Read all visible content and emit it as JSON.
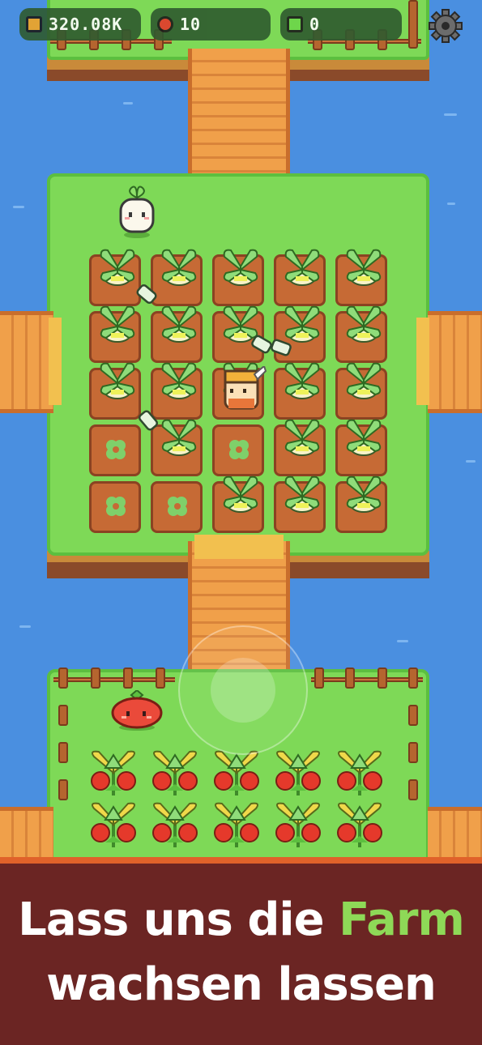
{
  "hud": {
    "coins": "320.08K",
    "tomatoes": "10",
    "gems": "0",
    "settings_icon": "gear-icon",
    "coin_icon": "coin-icon",
    "tomato_icon": "tomato-icon",
    "gem_icon": "gem-icon"
  },
  "banner": {
    "line1_prefix": "Lass uns die",
    "line1_highlight": "Farm",
    "line2": "wachsen lassen"
  },
  "colors": {
    "water": "#4a8fe0",
    "grass": "#7ed957",
    "banner_bg": "#6b2523",
    "highlight": "#8ed957"
  },
  "field": {
    "rows": [
      [
        "turnip",
        "turnip",
        "turnip",
        "turnip",
        "turnip"
      ],
      [
        "turnip",
        "turnip",
        "turnip",
        "turnip",
        "turnip"
      ],
      [
        "turnip",
        "turnip",
        "turnip",
        "turnip",
        "turnip"
      ],
      [
        "sprout",
        "turnip",
        "sprout",
        "turnip",
        "turnip"
      ],
      [
        "sprout",
        "sprout",
        "turnip",
        "turnip",
        "turnip"
      ]
    ]
  },
  "tomato_field": {
    "rows": [
      [
        "tomato",
        "tomato",
        "tomato",
        "tomato",
        "tomato"
      ],
      [
        "tomato",
        "tomato",
        "tomato",
        "tomato",
        "tomato"
      ]
    ]
  }
}
